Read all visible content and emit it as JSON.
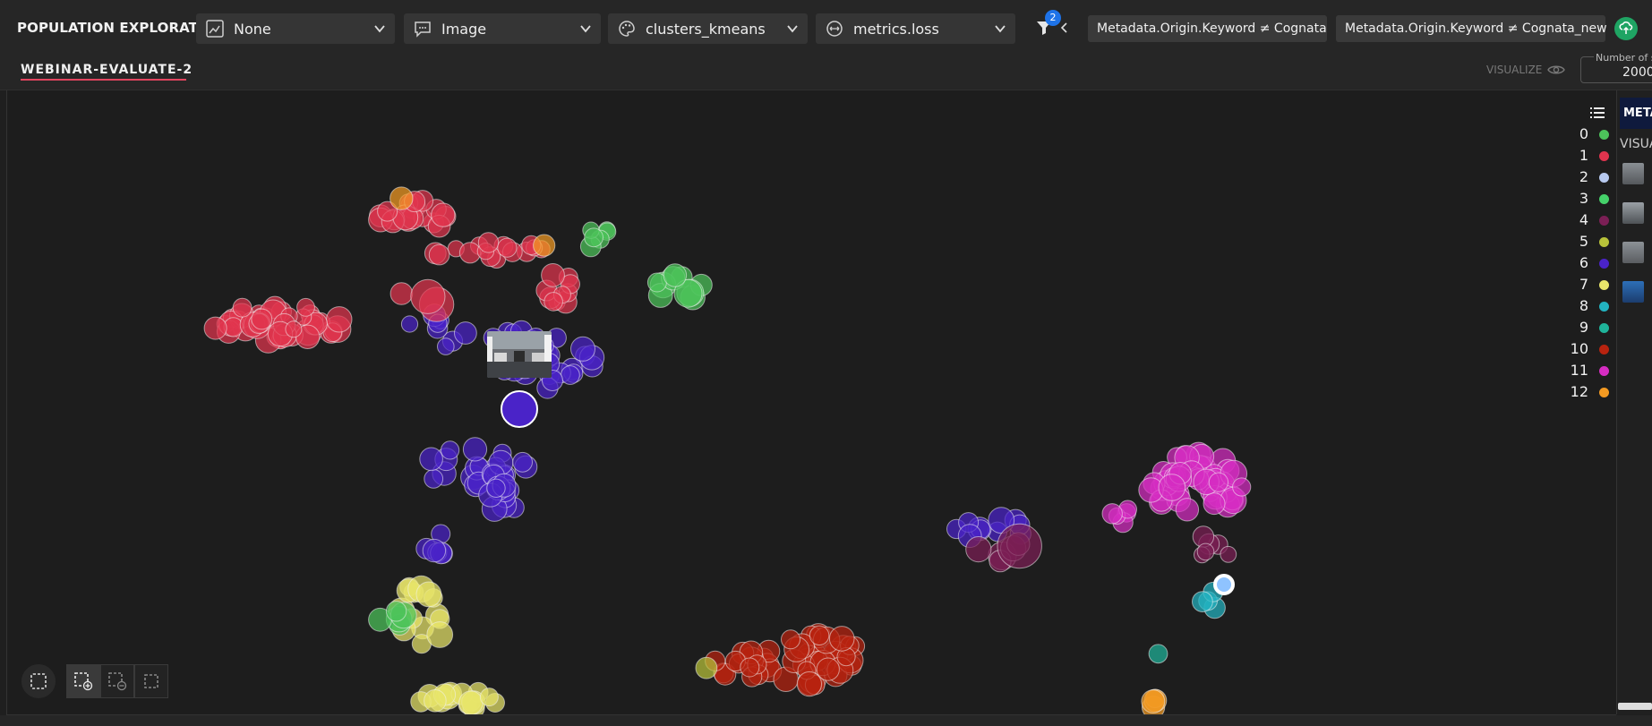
{
  "header": {
    "title": "POPULATION EXPLORATION",
    "dropdowns": [
      {
        "label": "None",
        "icon": "image-chart-icon"
      },
      {
        "label": "Image",
        "icon": "message-icon"
      },
      {
        "label": "clusters_kmeans",
        "icon": "palette-icon"
      },
      {
        "label": "metrics.loss",
        "icon": "size-icon"
      }
    ],
    "filter_count": "2",
    "filter_chips": [
      "Metadata.Origin.Keyword ≠ Cognata",
      "Metadata.Origin.Keyword ≠ Cognata_new"
    ]
  },
  "subbar": {
    "project_name": "WEBINAR-EVALUATE-2",
    "visualize_label": "VISUALIZE",
    "samples_label": "Number of s",
    "samples_value": "2000"
  },
  "legend": [
    {
      "label": "0",
      "color": "#4cc35a"
    },
    {
      "label": "1",
      "color": "#e0344e"
    },
    {
      "label": "2",
      "color": "#b7c9ef"
    },
    {
      "label": "3",
      "color": "#45d16a"
    },
    {
      "label": "4",
      "color": "#7b1f55"
    },
    {
      "label": "5",
      "color": "#b8c23a"
    },
    {
      "label": "6",
      "color": "#4a23c8"
    },
    {
      "label": "7",
      "color": "#e8e56a"
    },
    {
      "label": "8",
      "color": "#23b3c0"
    },
    {
      "label": "9",
      "color": "#1fb39a"
    },
    {
      "label": "10",
      "color": "#b8230f"
    },
    {
      "label": "11",
      "color": "#d62cc2"
    },
    {
      "label": "12",
      "color": "#f39a22"
    }
  ],
  "right_panel": {
    "tab_label": "METADATA",
    "section_label": "VISUALIZE"
  },
  "colors": {
    "accent": "#e2455f",
    "upload": "#1fa463",
    "badge": "#1e73e8"
  }
}
